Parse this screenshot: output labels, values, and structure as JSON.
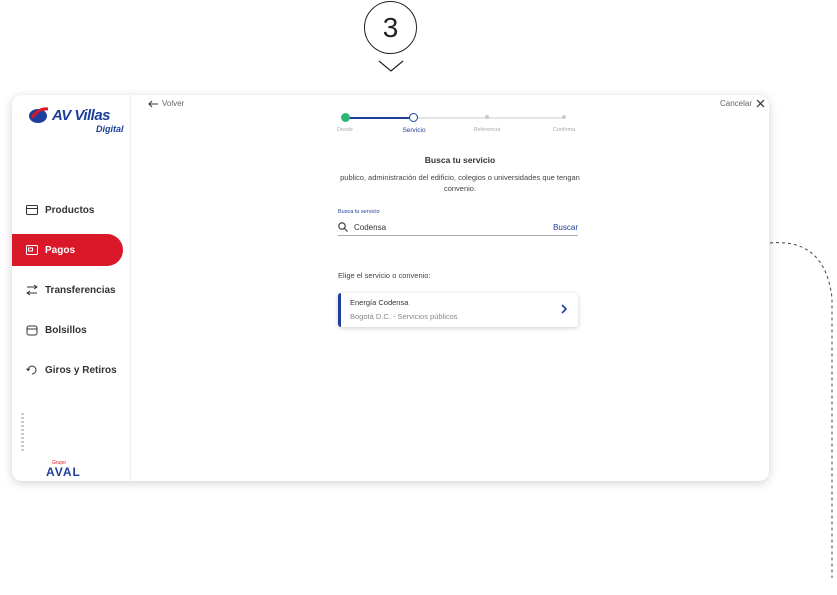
{
  "step_indicator": "3",
  "sidebar": {
    "logo": {
      "brand": "AV Villas",
      "sub": "Digital"
    },
    "items": [
      {
        "label": "Productos",
        "icon": "card-icon",
        "active": false
      },
      {
        "label": "Pagos",
        "icon": "bill-icon",
        "active": true
      },
      {
        "label": "Transferencias",
        "icon": "transfer-icon",
        "active": false
      },
      {
        "label": "Bolsillos",
        "icon": "pocket-icon",
        "active": false
      },
      {
        "label": "Giros y Retiros",
        "icon": "withdraw-icon",
        "active": false
      }
    ],
    "footer": {
      "grupo": "Grupo",
      "aval": "AVAL"
    }
  },
  "header": {
    "back_label": "Volver",
    "cancel_label": "Cancelar"
  },
  "stepper": {
    "steps": [
      {
        "label": "Desde",
        "state": "done"
      },
      {
        "label": "Servicio",
        "state": "current"
      },
      {
        "label": "Referencia",
        "state": "pending"
      },
      {
        "label": "Confirma",
        "state": "pending"
      }
    ]
  },
  "main": {
    "title": "Busca tu servicio",
    "subtitle": "publico, administración del edificio, colegios o universidades que tengan convenio.",
    "search_label": "Busca tu servicio",
    "search_value": "Codensa",
    "search_button": "Buscar",
    "choose_label": "Elige el servicio o convenio:",
    "result": {
      "name": "Energía Codensa",
      "detail": "Bogotá D.C. - Servicios públicos"
    }
  },
  "colors": {
    "brand_red": "#d9182a",
    "brand_blue": "#1d3e9b",
    "success_green": "#2bb673"
  }
}
